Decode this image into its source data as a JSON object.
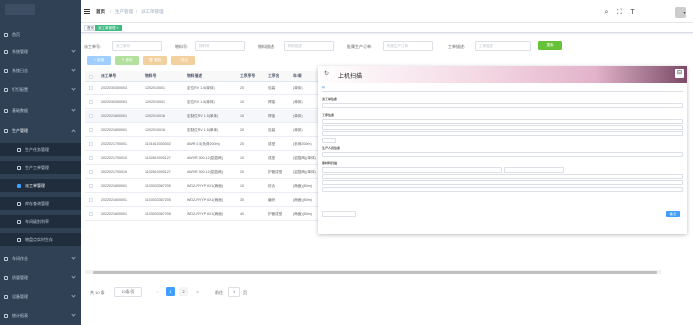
{
  "sidebar": {
    "items": [
      {
        "label": "首页",
        "icon": "home-icon"
      },
      {
        "label": "系统管理",
        "icon": "system-icon"
      },
      {
        "label": "系统日志",
        "icon": "log-icon"
      },
      {
        "label": "钉钉配置",
        "icon": "config-icon"
      },
      {
        "label": "基础数据",
        "icon": "data-icon"
      },
      {
        "label": "生产管理",
        "icon": "production-icon"
      }
    ],
    "subitems": [
      {
        "label": "生产任务管理",
        "icon": "task-icon"
      },
      {
        "label": "生产工单管理",
        "icon": "order-icon"
      },
      {
        "label": "派工单管理",
        "icon": "dispatch-icon"
      },
      {
        "label": "库存查询管理",
        "icon": "inventory-icon"
      },
      {
        "label": "车间级别利率",
        "icon": "rate-icon"
      },
      {
        "label": "物盘点实时生存",
        "icon": "count-icon"
      }
    ],
    "bottom_items": [
      {
        "label": "车间作业",
        "icon": "workshop-icon"
      },
      {
        "label": "质量管理",
        "icon": "quality-icon"
      },
      {
        "label": "设备管理",
        "icon": "equipment-icon"
      },
      {
        "label": "统计报表",
        "icon": "report-icon"
      }
    ]
  },
  "breadcrumb": [
    "首页",
    "生产管理",
    "派工单管理"
  ],
  "tags": {
    "home": "首页",
    "active": "派工单管理 ×"
  },
  "search": {
    "fields": [
      {
        "label": "派工单号:",
        "placeholder": "派工单号"
      },
      {
        "label": "物料号:",
        "placeholder": "物料号"
      },
      {
        "label": "物料描述:",
        "placeholder": "物料描述"
      },
      {
        "label": "批属生产订单:",
        "placeholder": "所属生产订单"
      },
      {
        "label": "工单描述:",
        "placeholder": "工单描述"
      }
    ],
    "search_btn": "搜索"
  },
  "toolbar": {
    "add": "+ 新增",
    "edit": "✎ 修改",
    "del": "🗑 删除",
    "export": "↓ 导出"
  },
  "table": {
    "headers": [
      "派工单号",
      "物料号",
      "物料描述",
      "工序序号",
      "工序名",
      "年/周"
    ],
    "rows": [
      [
        "2022030300003",
        "1202010001",
        "定位RV 1.5(单体)",
        "20",
        "包装",
        "(单体)"
      ],
      [
        "2022030300003",
        "1202010001",
        "定位RV 1.5(单体)",
        "10",
        "焊接",
        "(单体)"
      ],
      [
        "2022021600001",
        "1202010016",
        "定制位RV 1.5(单体)",
        "10",
        "焊接",
        "(单体)"
      ],
      [
        "2022021600001",
        "1202010016",
        "定制位RV 1.5(单体)",
        "20",
        "包装",
        "(单体)"
      ],
      [
        "2022021700001",
        "1101610303002",
        "AWR 0.5(负荷200m)",
        "20",
        "成型",
        "(负荷200m)"
      ],
      [
        "2022021700010",
        "1102610000127",
        "AWVR 300.12(铝箔两)",
        "10",
        "成型",
        "(铝箔两)(单体)"
      ],
      [
        "2022021700019",
        "1102610000127",
        "AWVR 300.12(铝箔两)",
        "20",
        "护套成型",
        "(铝箔两)(单体)"
      ],
      [
        "2022021600001",
        "1103033367205",
        "WDZ-RYYP 6X1(两面)",
        "10",
        "绞合",
        "(两面)(50m)"
      ],
      [
        "2022021600001",
        "1103033367205",
        "WDZ-RYYP 6X1(两面)",
        "30",
        "编织",
        "(两面)(50m)"
      ],
      [
        "2022021600001",
        "1103033367205",
        "WDZ-RYYP 6X1(两面)",
        "40",
        "护套成型",
        "(两面)(50m)"
      ]
    ]
  },
  "pagination": {
    "total": "共 10 条",
    "size": "10条/页",
    "prev": "<",
    "pages": [
      "1",
      "2"
    ],
    "next": ">",
    "goto": "前往",
    "page_input": "1",
    "page_unit": "页"
  },
  "dialog": {
    "title": "上机扫描",
    "s1": "派工单信息",
    "s2": "工序信息",
    "s3": "生产人员信息",
    "s4": "原材料扫描",
    "confirm": "确 定",
    "cancel": "取 消"
  },
  "colors": {
    "sidebar": "#304156",
    "primary": "#409eff",
    "success": "#67c23a",
    "warning": "#e6a23c",
    "tag": "#42b983"
  }
}
